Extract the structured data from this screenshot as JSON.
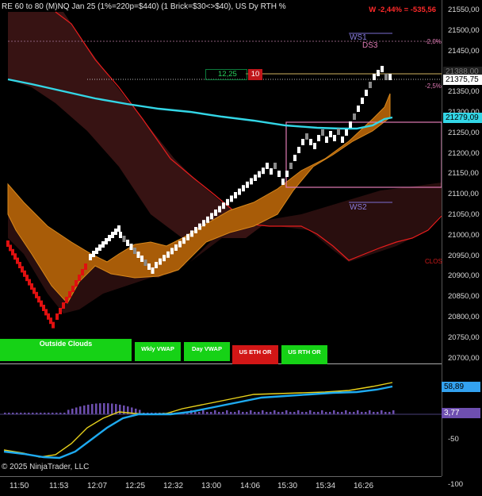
{
  "header": {
    "title": "RE 60 to 80 (M)NQ Jan 25 (1%=220p=$440) (1 Brick=$30<>$40), US Dy RTH %",
    "pnl": "W -2,44% = -535,56"
  },
  "price_axis": {
    "ticks": [
      "21550,00",
      "21500,00",
      "21450,00",
      "21400,00",
      "21350,00",
      "21300,00",
      "21250,00",
      "21200,00",
      "21150,00",
      "21100,00",
      "21050,00",
      "21000,00",
      "20950,00",
      "20900,00",
      "20850,00",
      "20800,00",
      "20750,00",
      "20700,00"
    ],
    "last_price": "21375,75",
    "prev_label": "21388,00",
    "vwap_price": "21279,09"
  },
  "oscillator_axis": {
    "ticks": [
      "50",
      "-50",
      "-100"
    ],
    "value_primary": "58,89",
    "value_secondary": "3,77"
  },
  "time_axis": {
    "ticks": [
      "11:50",
      "11:53",
      "12:07",
      "12:25",
      "12:32",
      "13:00",
      "14:06",
      "15:30",
      "15:34",
      "16:26"
    ]
  },
  "chart_overlays": {
    "ws1_label": "WS1",
    "ds3_label": "DS3",
    "ws2_label": "WS2",
    "pct_upper": "-2,0%",
    "pct_lower": "-2,5%",
    "close_label": "CLOS",
    "brick_count_last": "12,25",
    "brick_count": "10"
  },
  "buttons": {
    "outside_clouds": "Outside Clouds",
    "wkly_vwap": "Wkly VWAP",
    "day_vwap": "Day VWAP",
    "us_eth_or": "US ETH OR",
    "us_rth_or": "US RTH OR"
  },
  "footer": {
    "copyright": "© 2025 NinjaTrader, LLC"
  },
  "colors": {
    "up_brick": "#ffffff",
    "down_brick": "#e01010",
    "neutral_brick": "#8a8a8a",
    "cloud_fill": "#a85c08",
    "band_fill": "#3a1414",
    "band_line": "#e81d1d",
    "vwap_line": "#33d6e6",
    "osc_fast": "#e8d21c",
    "osc_slow": "#1eaaf0",
    "histogram": "#6e4fb0",
    "button_green": "#16d216",
    "button_red": "#d21616",
    "pnl_red": "#ff2a2a"
  }
}
